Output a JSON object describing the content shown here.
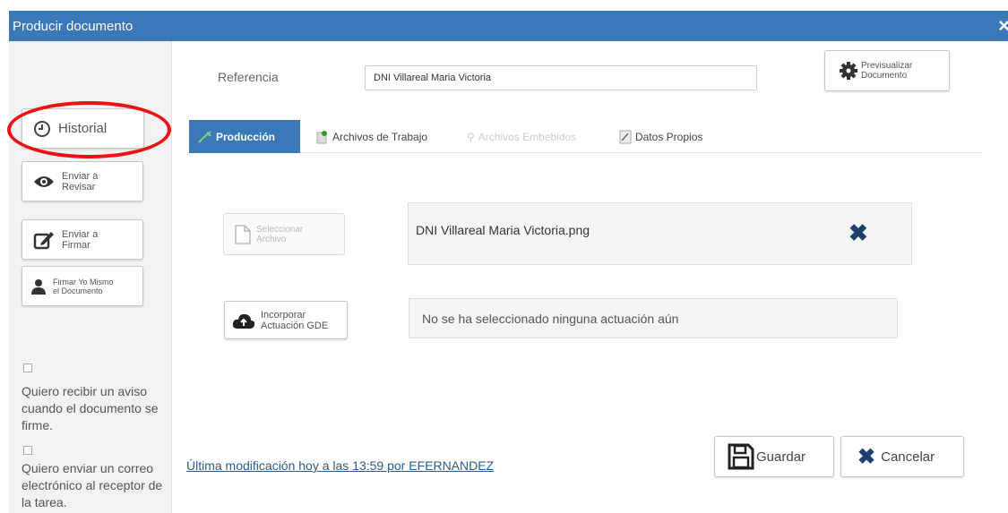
{
  "window": {
    "title": "Producir documento",
    "close_glyph": "×"
  },
  "sidebar": {
    "historial_label": "Historial",
    "enviar_revisar": [
      "Enviar a",
      "Revisar"
    ],
    "enviar_firmar": [
      "Enviar a",
      "Firmar"
    ],
    "firmar_yo_mismo": [
      "Firmar Yo Mismo",
      "el Documento"
    ],
    "checkbox_aviso_text": "Quiero recibir un aviso cuando el documento se firme.",
    "checkbox_correo_text": "Quiero enviar un correo electrónico al receptor de la tarea."
  },
  "header": {
    "referencia_label": "Referencia",
    "referencia_value": "DNI Villareal Maria Victoria",
    "previsualizar": [
      "Previsualizar",
      "Documento"
    ]
  },
  "tabs": [
    {
      "label": "Producción",
      "active": true
    },
    {
      "label": "Archivos de Trabajo",
      "active": false
    },
    {
      "label": "Archivos Embebidos",
      "active": false,
      "disabled": true
    },
    {
      "label": "Datos Propios",
      "active": false
    }
  ],
  "produccion": {
    "seleccionar_archivo": [
      "Seleccionar",
      "Archivo"
    ],
    "file_name": "DNI Villareal Maria Victoria.png",
    "remove_glyph": "✖",
    "incorporar": [
      "Incorporar",
      "Actuación GDE"
    ],
    "actuacion_status": "No se ha seleccionado ninguna actuación aún"
  },
  "footer": {
    "last_modified": "Última modificación hoy a las 13:59 por EFERNANDEZ",
    "guardar_label": "Guardar",
    "cancelar_label": "Cancelar"
  },
  "colors": {
    "accent": "#3a78b8",
    "highlight": "#e11111",
    "remove_icon": "#1f3f6b"
  },
  "icons": {
    "historial": "clock-icon",
    "revisar": "eye-icon",
    "firmar": "edit-icon",
    "firmar_yo": "user-icon",
    "previsualizar": "gear-icon",
    "produccion": "wrench-icon",
    "archivos_trabajo": "paperclip-icon",
    "datos_propios": "document-icon",
    "seleccionar": "file-icon",
    "incorporar": "cloud-upload-icon",
    "guardar": "save-icon",
    "cancelar": "close-icon"
  }
}
